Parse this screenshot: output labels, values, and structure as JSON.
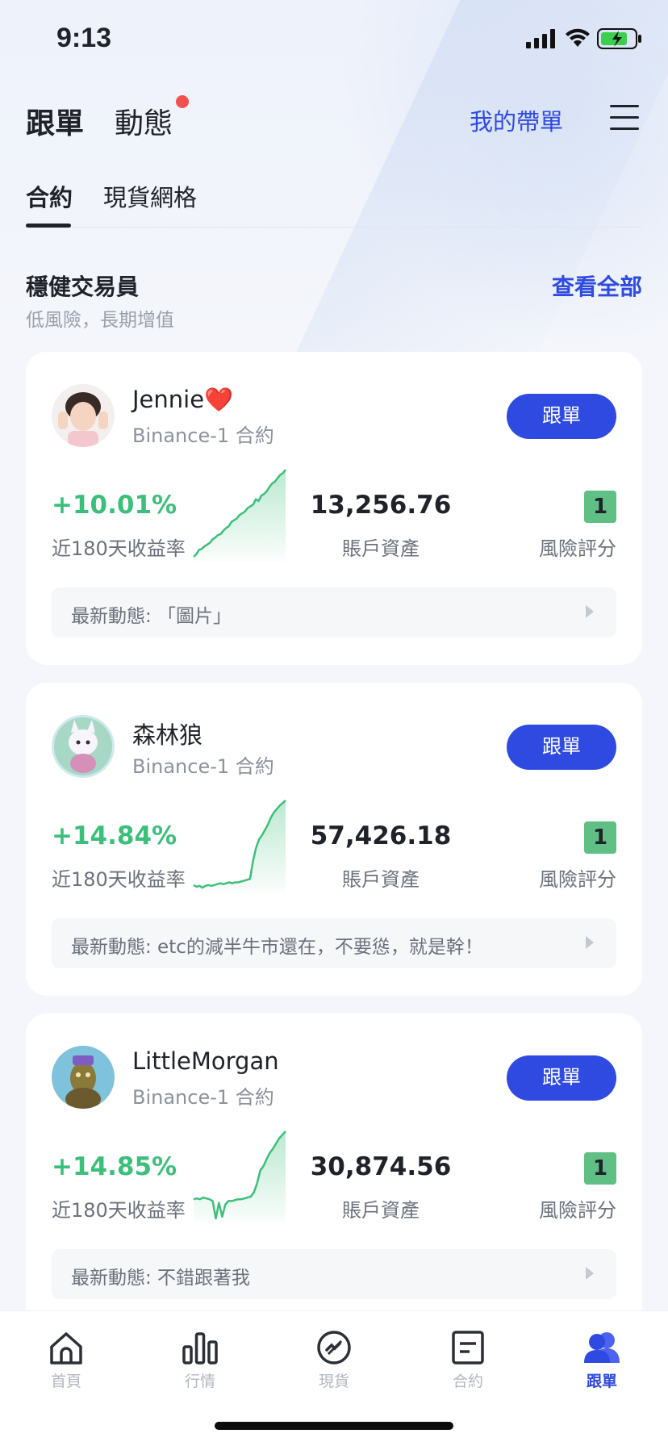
{
  "status_bar": {
    "time": "9:13"
  },
  "header": {
    "tab_follow": "跟單",
    "tab_feed": "動態",
    "my_lead": "我的帶單"
  },
  "subtabs": [
    "合約",
    "現貨網格"
  ],
  "section": {
    "title": "穩健交易員",
    "subtitle": "低風險，長期增值",
    "view_all": "查看全部"
  },
  "labels": {
    "follow_button": "跟單",
    "pnl_label": "近180天收益率",
    "assets_label": "賬戶資產",
    "risk_label": "風險評分"
  },
  "traders": [
    {
      "name": "Jennie❤️",
      "sub": "Binance-1 合約",
      "pnl": "+10.01%",
      "assets": "13,256.76",
      "risk": "1",
      "news": "最新動態: 「圖片」",
      "spark": [
        0,
        3,
        8,
        9,
        12,
        14,
        16,
        20,
        22,
        25,
        26,
        30,
        33,
        35,
        40,
        42,
        44,
        48,
        50,
        52,
        56,
        58,
        60,
        66,
        64,
        70,
        72,
        75,
        80,
        84,
        86,
        90,
        94,
        96,
        100
      ]
    },
    {
      "name": "森林狼",
      "sub": "Binance-1 合約",
      "pnl": "+14.84%",
      "assets": "57,426.18",
      "risk": "1",
      "news": "最新動態: etc的減半牛市還在，不要慫，就是幹！",
      "spark": [
        3,
        1,
        2,
        0,
        2,
        3,
        2,
        3,
        4,
        5,
        4,
        5,
        6,
        5,
        6,
        6,
        7,
        8,
        9,
        10,
        30,
        45,
        55,
        60,
        66,
        72,
        80,
        86,
        90,
        94,
        97,
        100
      ]
    },
    {
      "name": "LittleMorgan",
      "sub": "Binance-1 合約",
      "pnl": "+14.85%",
      "assets": "30,874.56",
      "risk": "1",
      "news": "最新動態: 不錯跟著我",
      "spark": [
        22,
        23,
        22,
        24,
        23,
        22,
        20,
        0,
        18,
        2,
        16,
        20,
        20,
        21,
        22,
        22,
        23,
        24,
        25,
        30,
        40,
        55,
        60,
        68,
        75,
        80,
        86,
        92,
        96,
        100
      ]
    }
  ],
  "nav": [
    {
      "label": "首頁",
      "icon": "home-icon"
    },
    {
      "label": "行情",
      "icon": "bar-chart-icon"
    },
    {
      "label": "現貨",
      "icon": "spot-icon"
    },
    {
      "label": "合約",
      "icon": "contract-icon"
    },
    {
      "label": "跟單",
      "icon": "copy-trade-icon"
    }
  ],
  "colors": {
    "accent": "#2f4ae0",
    "positive": "#3cbf7a",
    "risk_badge": "#5fbf85",
    "notification": "#f0534f"
  }
}
